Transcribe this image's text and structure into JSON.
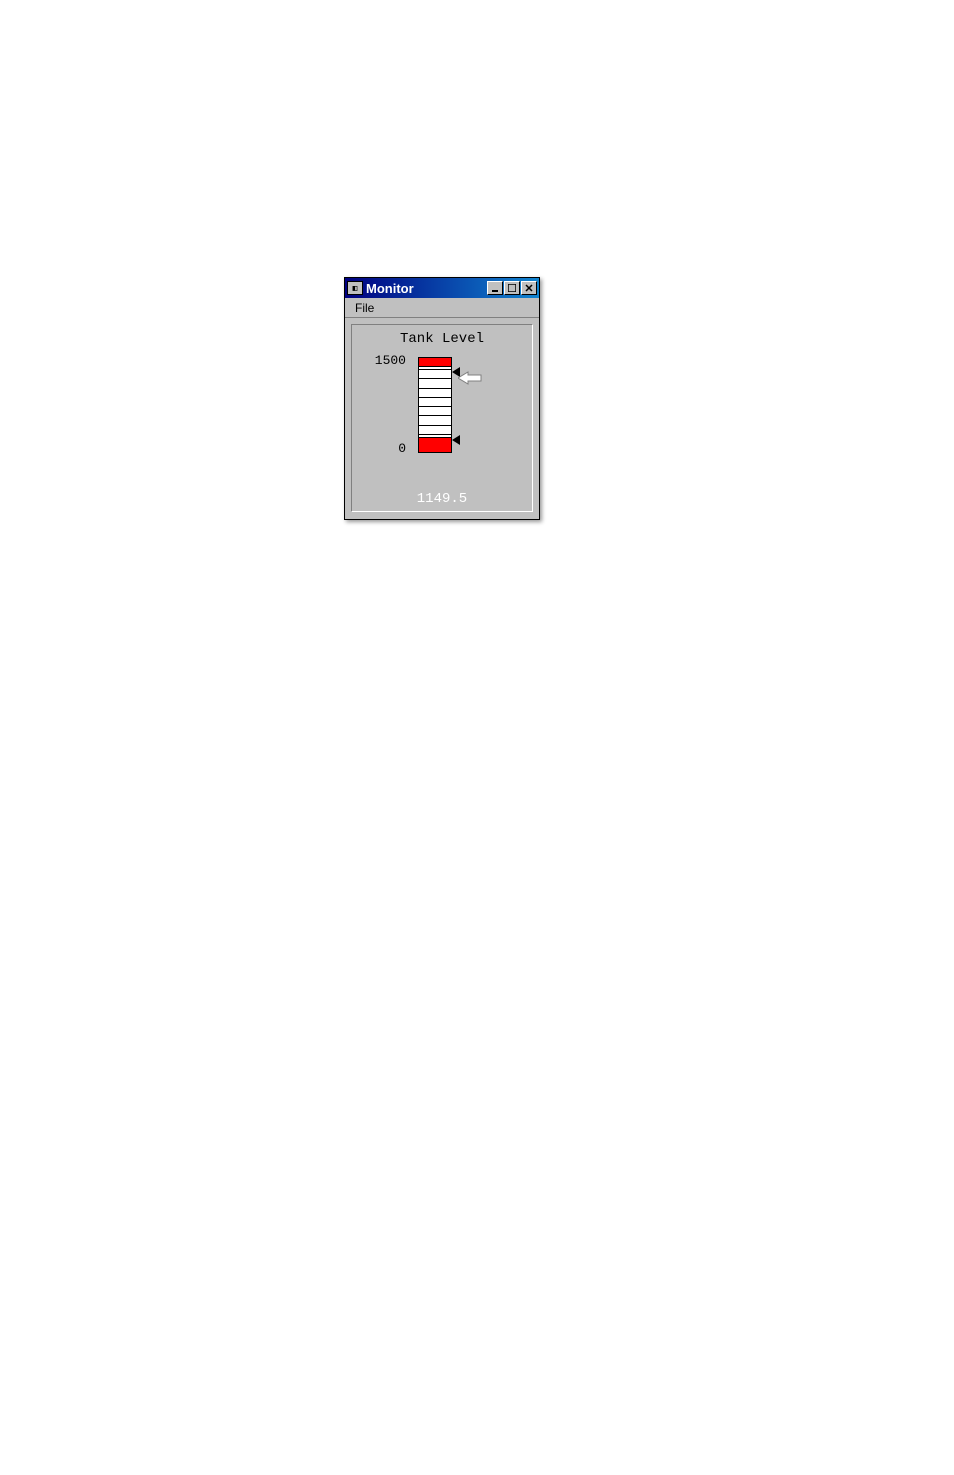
{
  "window": {
    "title": "Monitor",
    "controls": {
      "minimize": "_",
      "maximize": "□",
      "close": "×"
    }
  },
  "menubar": {
    "items": [
      "File"
    ]
  },
  "gauge": {
    "title": "Tank Level",
    "max_label": "1500",
    "min_label": "0",
    "readout": "1149.5",
    "chart_data": {
      "type": "gauge",
      "min": 0,
      "max": 1500,
      "value": 1149.5,
      "upper_redzone": [
        1350,
        1500
      ],
      "lower_redzone": [
        0,
        200
      ],
      "upper_marker": 1280,
      "lower_marker": 180
    }
  }
}
